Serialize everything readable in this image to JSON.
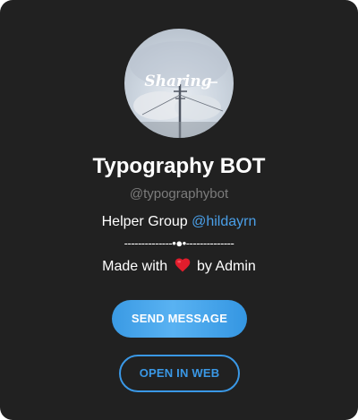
{
  "profile": {
    "avatar_text": "Sharing",
    "title": "Typography BOT",
    "username": "@typographybot"
  },
  "description": {
    "helper_prefix": "Helper Group ",
    "helper_link": "@hildayrn",
    "divider": "--------------•●•--------------",
    "made_with_prefix": "Made with",
    "heart_icon": "heart-icon",
    "made_with_suffix": "by Admin"
  },
  "actions": {
    "send_message_label": "SEND MESSAGE",
    "open_in_web_label": "OPEN IN WEB"
  },
  "colors": {
    "background": "#212121",
    "link": "#4a9fe8",
    "accent": "#3a98e6",
    "heart": "#e11d2c"
  }
}
